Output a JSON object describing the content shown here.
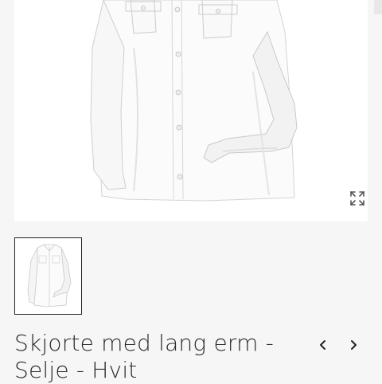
{
  "product": {
    "title_line1": "Skjorte med lang erm -",
    "title_line2": "Selje - Hvit"
  },
  "gallery": {
    "main_image_alt": "Skjorte med lang erm - Selje - Hvit",
    "zoom_icon": "expand-arrows-icon",
    "thumbnails": [
      {
        "alt": "Skjorte med lang erm - Selje - Hvit",
        "selected": true
      }
    ]
  },
  "navigation": {
    "prev_icon": "chevron-left-icon",
    "next_icon": "chevron-right-icon"
  },
  "colors": {
    "background": "#f6f6f6",
    "image_background": "#ffffff",
    "text": "#2a2a2a",
    "thumbnail_border": "#222222"
  }
}
